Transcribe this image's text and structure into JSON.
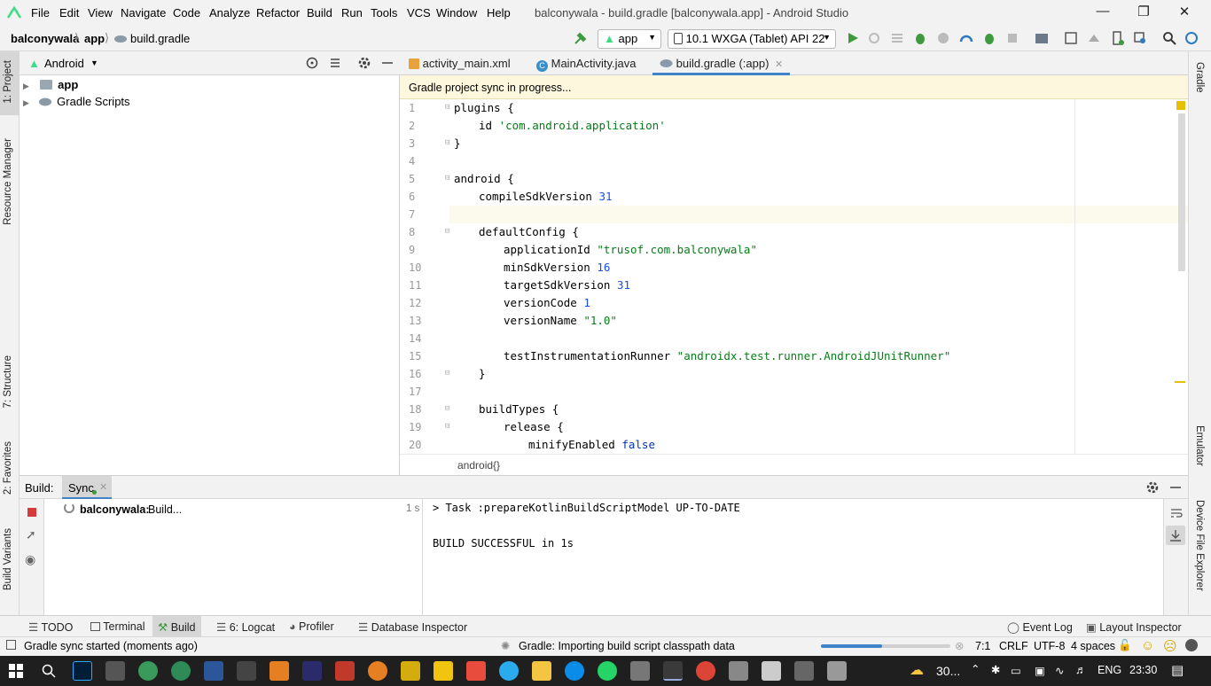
{
  "app": {
    "window_title": "balconywala - build.gradle [balconywala.app] - Android Studio",
    "menu": [
      "File",
      "Edit",
      "View",
      "Navigate",
      "Code",
      "Analyze",
      "Refactor",
      "Build",
      "Run",
      "Tools",
      "VCS",
      "Window",
      "Help"
    ]
  },
  "nav": {
    "breadcrumb": [
      "balconywala",
      "app",
      "build.gradle"
    ],
    "run_config": "app",
    "device": "10.1  WXGA (Tablet) API 22"
  },
  "left_stripe": {
    "project": "1: Project",
    "resource_manager": "Resource Manager",
    "structure": "7: Structure",
    "favorites": "2: Favorites",
    "build_variants": "Build Variants"
  },
  "right_stripe": {
    "gradle": "Gradle",
    "emulator": "Emulator",
    "device_file_explorer": "Device File Explorer"
  },
  "project_panel": {
    "view_mode": "Android",
    "items": [
      {
        "label": "app"
      },
      {
        "label": "Gradle Scripts"
      }
    ]
  },
  "editor": {
    "tabs": [
      {
        "label": "activity_main.xml"
      },
      {
        "label": "MainActivity.java"
      },
      {
        "label": "build.gradle (:app)"
      }
    ],
    "sync_banner": "Gradle project sync in progress...",
    "line_numbers": [
      "1",
      "2",
      "3",
      "4",
      "5",
      "6",
      "7",
      "8",
      "9",
      "10",
      "11",
      "12",
      "13",
      "14",
      "15",
      "16",
      "17",
      "18",
      "19",
      "20"
    ],
    "code": {
      "l1": "plugins {",
      "l2_kw": "id ",
      "l2_str": "'com.android.application'",
      "l3": "}",
      "l5": "android {",
      "l6_kw": "compileSdkVersion ",
      "l6_num": "31",
      "l8": "defaultConfig {",
      "l9_kw": "applicationId ",
      "l9_str": "\"trusof.com.balconywala\"",
      "l10_kw": "minSdkVersion ",
      "l10_num": "16",
      "l11_kw": "targetSdkVersion ",
      "l11_num": "31",
      "l12_kw": "versionCode ",
      "l12_num": "1",
      "l13_kw": "versionName ",
      "l13_str": "\"1.0\"",
      "l15_kw": "testInstrumentationRunner ",
      "l15_str": "\"androidx.test.runner.AndroidJUnitRunner\"",
      "l16": "}",
      "l18": "buildTypes {",
      "l19": "release {",
      "l20_kw": "minifyEnabled ",
      "l20_val": "false"
    },
    "breadcrumb": "android{}"
  },
  "build_panel": {
    "title": "Build:",
    "tab": "Sync",
    "task_label": "balconywala:",
    "task_status": "Build...",
    "task_time": "1 s",
    "output_line1": "> Task :prepareKotlinBuildScriptModel UP-TO-DATE",
    "output_line2": "BUILD SUCCESSFUL in 1s"
  },
  "tool_tabs": {
    "todo": "TODO",
    "terminal": "Terminal",
    "build": "Build",
    "logcat": "6: Logcat",
    "profiler": "Profiler",
    "database_inspector": "Database Inspector",
    "event_log": "Event Log",
    "layout_inspector": "Layout Inspector"
  },
  "status_bar": {
    "message": "Gradle sync started (moments ago)",
    "progress_text": "Gradle: Importing build script classpath data",
    "progress": 0.47,
    "position": "7:1",
    "line_sep": "CRLF",
    "encoding": "UTF-8",
    "indent": "4 spaces"
  },
  "taskbar": {
    "weather": "30...",
    "language": "ENG",
    "time": "23:30"
  },
  "colors": {
    "accent": "#4083c9",
    "android_green": "#3ddc84",
    "banner": "#fdf8dd"
  }
}
